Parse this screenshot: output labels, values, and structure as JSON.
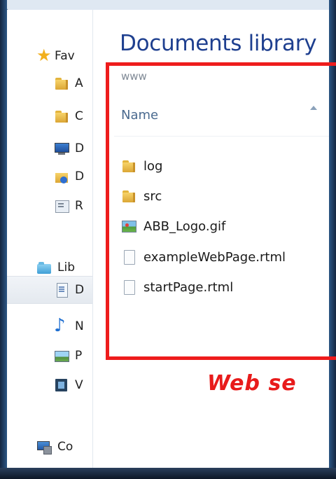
{
  "nav": {
    "items": [
      {
        "label": "Fav",
        "icon": "star-icon"
      },
      {
        "label": "A",
        "icon": "folder-icon"
      },
      {
        "label": "C",
        "icon": "folder-icon"
      },
      {
        "label": "D",
        "icon": "monitor-icon"
      },
      {
        "label": "D",
        "icon": "downloads-folder-icon"
      },
      {
        "label": "R",
        "icon": "recent-places-icon"
      },
      {
        "label": "Lib",
        "icon": "libraries-icon"
      },
      {
        "label": "D",
        "icon": "documents-icon"
      },
      {
        "label": "N",
        "icon": "music-icon"
      },
      {
        "label": "P",
        "icon": "pictures-icon"
      },
      {
        "label": "V",
        "icon": "videos-icon"
      },
      {
        "label": "Co",
        "icon": "computer-icon"
      }
    ]
  },
  "content": {
    "title": "Documents library",
    "breadcrumb": "www",
    "column_name": "Name",
    "files": [
      {
        "name": "log",
        "icon": "folder-icon"
      },
      {
        "name": "src",
        "icon": "folder-icon"
      },
      {
        "name": "ABB_Logo.gif",
        "icon": "image-file-icon"
      },
      {
        "name": "exampleWebPage.rtml",
        "icon": "file-icon"
      },
      {
        "name": "startPage.rtml",
        "icon": "file-icon"
      }
    ]
  },
  "annotation": {
    "caption": "Web se",
    "color": "#ee1c1c"
  }
}
